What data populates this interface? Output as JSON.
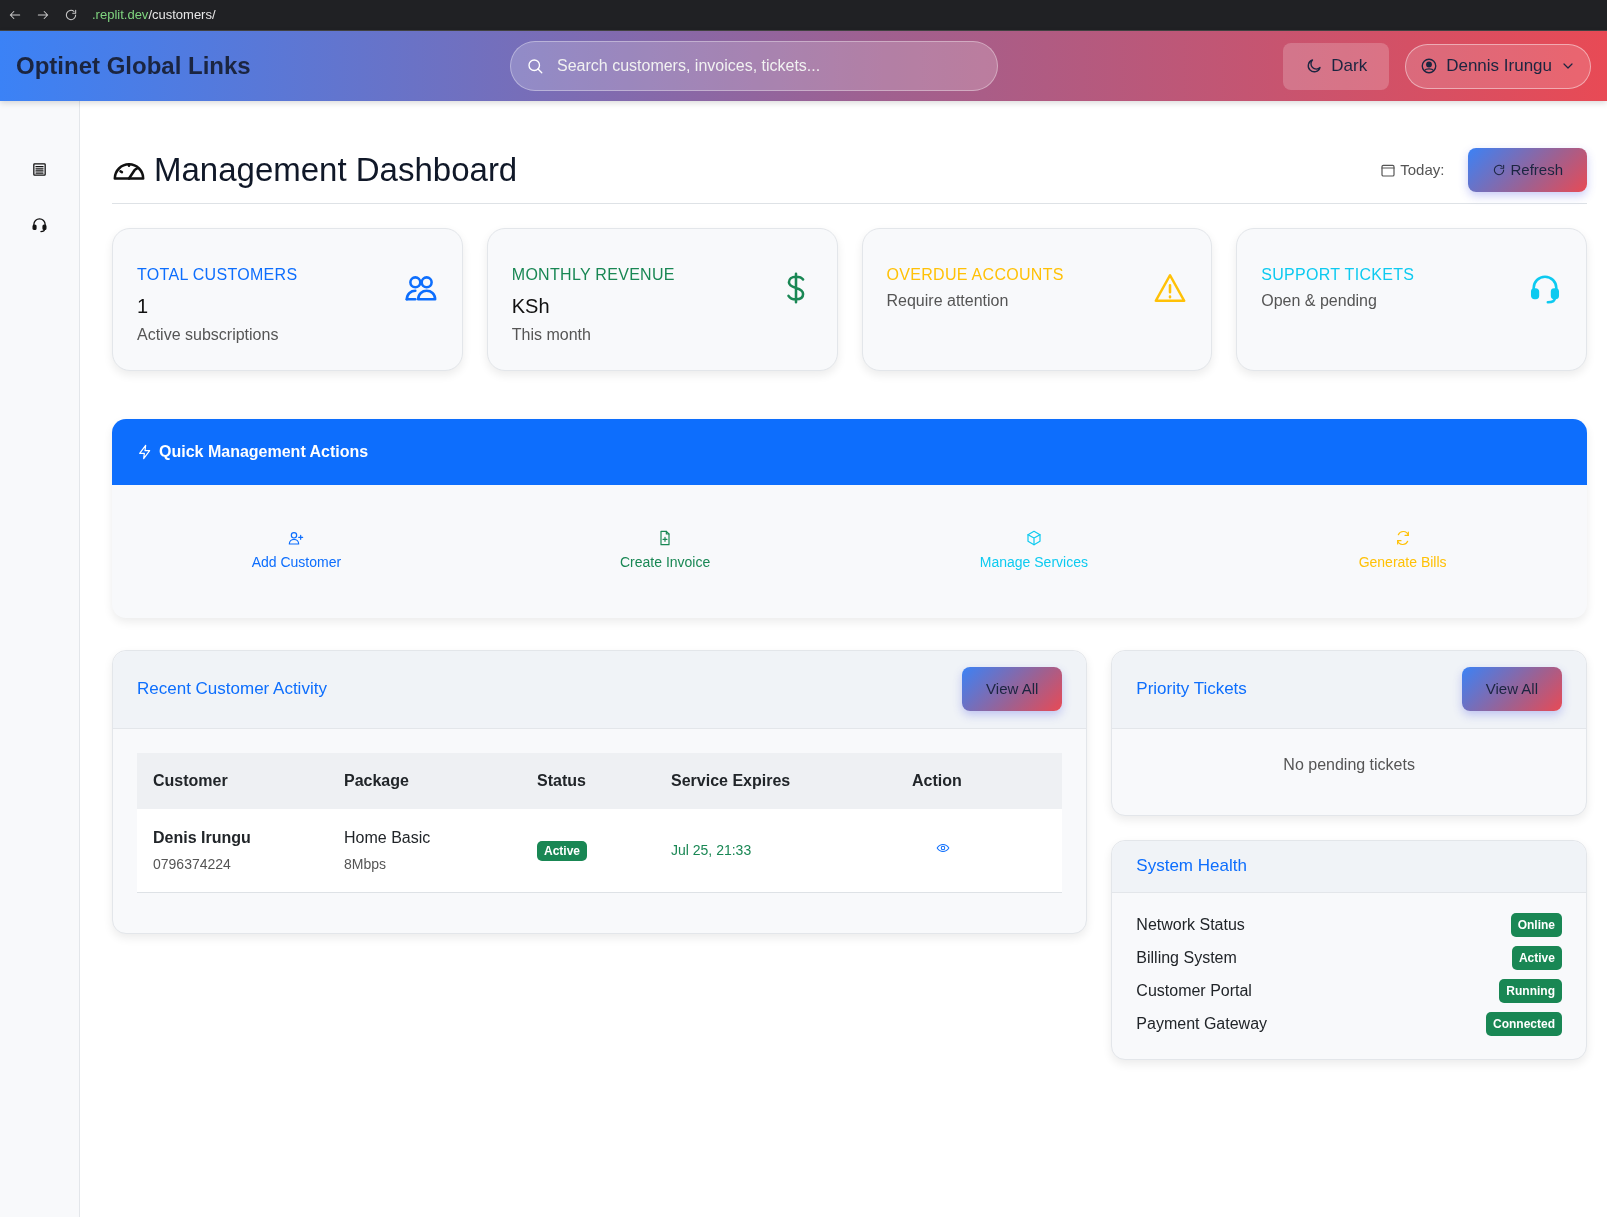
{
  "browser": {
    "url_domain": ".replit.dev",
    "url_path": "/customers/"
  },
  "header": {
    "brand": "Optinet Global Links",
    "search_placeholder": "Search customers, invoices, tickets...",
    "theme_button": "Dark",
    "user": "Dennis Irungu"
  },
  "sidebar": {
    "items": [
      {
        "kind": "list"
      },
      {
        "kind": "headset"
      }
    ]
  },
  "page": {
    "title": "Management Dashboard",
    "today_label": "Today:",
    "refresh_button": "Refresh"
  },
  "stat_cards": [
    {
      "kind": "people",
      "color": "#0d6efd",
      "title": "TOTAL CUSTOMERS",
      "value": "1",
      "subtitle": "Active subscriptions"
    },
    {
      "kind": "dollar",
      "color": "#198754",
      "title": "MONTHLY REVENUE",
      "value": "KSh",
      "subtitle": "This month"
    },
    {
      "kind": "warning",
      "color": "#ffc107",
      "title": "OVERDUE ACCOUNTS",
      "subtitle": "Require attention"
    },
    {
      "kind": "headset",
      "color": "#0dcaf0",
      "title": "SUPPORT TICKETS",
      "subtitle": "Open & pending"
    }
  ],
  "quick_actions": {
    "title": "Quick Management Actions",
    "items": [
      {
        "kind": "person-add",
        "color": "#0d6efd",
        "label": "Add Customer"
      },
      {
        "kind": "file-add",
        "color": "#198754",
        "label": "Create Invoice"
      },
      {
        "kind": "box",
        "color": "#0dcaf0",
        "label": "Manage Services"
      },
      {
        "kind": "cycle",
        "color": "#ffc107",
        "label": "Generate Bills"
      }
    ]
  },
  "recent_activity": {
    "title": "Recent Customer Activity",
    "button": "View All",
    "columns": [
      "Customer",
      "Package",
      "Status",
      "Service Expires",
      "Action"
    ],
    "rows": [
      {
        "customer": "Denis Irungu",
        "phone": "0796374224",
        "package": "Home Basic",
        "speed": "8Mbps",
        "status": "Active",
        "expires": "Jul 25, 21:33"
      }
    ]
  },
  "priority_tickets": {
    "title": "Priority Tickets",
    "button": "View All",
    "empty": "No pending tickets"
  },
  "system_health": {
    "title": "System Health",
    "items": [
      {
        "label": "Network Status",
        "status": "Online"
      },
      {
        "label": "Billing System",
        "status": "Active"
      },
      {
        "label": "Customer Portal",
        "status": "Running"
      },
      {
        "label": "Payment Gateway",
        "status": "Connected"
      }
    ]
  }
}
